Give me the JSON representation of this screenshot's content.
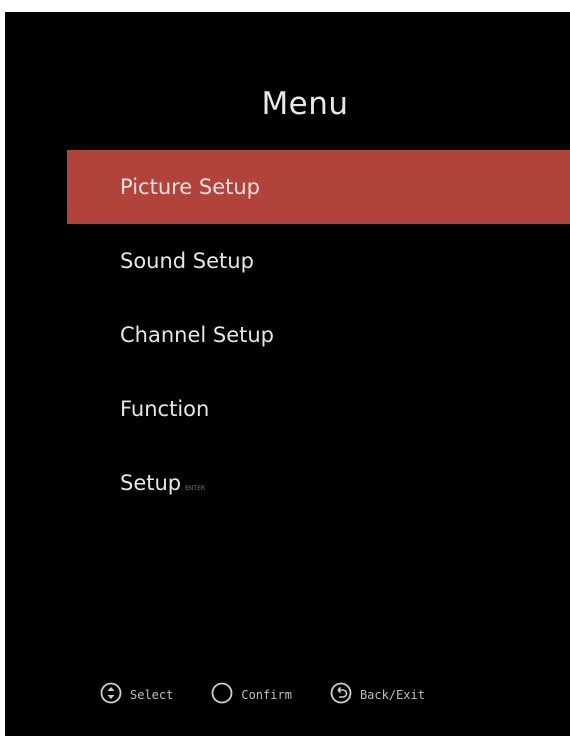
{
  "menu": {
    "title": "Menu",
    "items": [
      {
        "label": "Picture Setup",
        "selected": true
      },
      {
        "label": "Sound Setup",
        "selected": false
      },
      {
        "label": "Channel Setup",
        "selected": false
      },
      {
        "label": "Function",
        "selected": false
      },
      {
        "label": "Setup",
        "suffix": "ENTER",
        "selected": false
      }
    ]
  },
  "footer": {
    "select_label": "Select",
    "confirm_label": "Confirm",
    "back_label": "Back/Exit"
  },
  "colors": {
    "background": "#000000",
    "highlight": "#b2433a",
    "text": "#e6e6e6"
  },
  "icons": [
    "up-down-icon",
    "circle-icon",
    "back-arrow-icon"
  ]
}
